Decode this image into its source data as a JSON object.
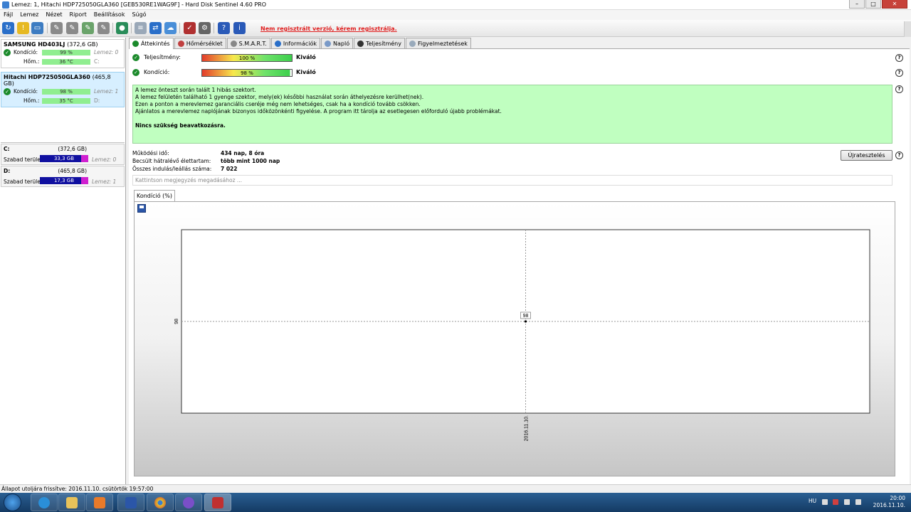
{
  "window": {
    "title": "Lemez: 1, Hitachi HDP725050GLA360 [GEB530RE1WAG9F]  -  Hard Disk Sentinel 4.60 PRO"
  },
  "menu": [
    "Fájl",
    "Lemez",
    "Nézet",
    "Riport",
    "Beállítások",
    "Súgó"
  ],
  "toolbar": {
    "register_message": "Nem regisztrált verzió, kérem regisztrálja."
  },
  "disks": [
    {
      "name": "SAMSUNG HD403LJ",
      "size": "(372,6 GB)",
      "condition_label": "Kondíció:",
      "condition_value": "99 %",
      "condition_ext": "Lemez: 0",
      "temp_label": "Hőm.:",
      "temp_value": "36 °C",
      "temp_ext": "C:"
    },
    {
      "name": "Hitachi HDP725050GLA360",
      "size": "(465,8 GB)",
      "condition_label": "Kondíció:",
      "condition_value": "98 %",
      "condition_ext": "Lemez: 1",
      "temp_label": "Hőm.:",
      "temp_value": "35 °C",
      "temp_ext": "D:"
    }
  ],
  "volumes": [
    {
      "letter": "C:",
      "size": "(372,6 GB)",
      "free_label": "Szabad terület",
      "free_value": "33,3 GB",
      "disk": "Lemez: 0"
    },
    {
      "letter": "D:",
      "size": "(465,8 GB)",
      "free_label": "Szabad terület",
      "free_value": "17,3 GB",
      "disk": "Lemez: 1"
    }
  ],
  "tabs": [
    "Áttekintés",
    "Hőmérséklet",
    "S.M.A.R.T.",
    "Információk",
    "Napló",
    "Teljesítmény",
    "Figyelmeztetések"
  ],
  "overview": {
    "performance_label": "Teljesítmény:",
    "performance_value": "100 %",
    "performance_quality": "Kiváló",
    "condition_label": "Kondíció:",
    "condition_value": "98 %",
    "condition_quality": "Kiváló",
    "message_lines": [
      "A lemez önteszt során talált 1 hibás szektort.",
      "A lemez felületén található 1 gyenge szektor, mely(ek) későbbi használat során áthelyezésre kerülhet(nek).",
      "Ezen a ponton a merevlemez garanciális cseréje még nem lehetséges, csak ha a kondíció tovább csökken.",
      "Ajánlatos a merevlemez naplójának bizonyos időközönkénti figyelése. A program itt tárolja az esetlegesen előforduló újabb problémákat."
    ],
    "message_bold": "Nincs szükség beavatkozásra.",
    "uptime_label": "Működési idő:",
    "uptime_value": "434 nap, 8 óra",
    "lifetime_label": "Becsült hátralévő élettartam:",
    "lifetime_value": "több mint 1000 nap",
    "startstop_label": "Összes indulás/leállás száma:",
    "startstop_value": "7 022",
    "retest_button": "Újratesztelés",
    "note_placeholder": "Kattintson megjegyzés megadásához ..."
  },
  "chart_tab": "Kondíció  (%)",
  "chart_data": {
    "type": "line",
    "x": [
      "2016.11.10."
    ],
    "series": [
      {
        "values": [
          98
        ]
      }
    ],
    "ytick": "98",
    "point_label": "98",
    "grid": true
  },
  "statusbar": "Állapot utoljára frissítve: 2016.11.10. csütörtök 19:57:00",
  "taskbar": {
    "language": "HU",
    "time": "20:00",
    "date": "2016.11.10."
  }
}
